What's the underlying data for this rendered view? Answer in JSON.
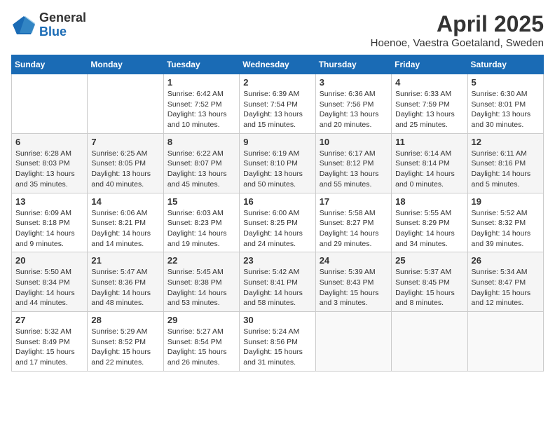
{
  "header": {
    "logo_general": "General",
    "logo_blue": "Blue",
    "month": "April 2025",
    "location": "Hoenoe, Vaestra Goetaland, Sweden"
  },
  "days_of_week": [
    "Sunday",
    "Monday",
    "Tuesday",
    "Wednesday",
    "Thursday",
    "Friday",
    "Saturday"
  ],
  "weeks": [
    [
      {
        "day": "",
        "info": ""
      },
      {
        "day": "",
        "info": ""
      },
      {
        "day": "1",
        "info": "Sunrise: 6:42 AM\nSunset: 7:52 PM\nDaylight: 13 hours and 10 minutes."
      },
      {
        "day": "2",
        "info": "Sunrise: 6:39 AM\nSunset: 7:54 PM\nDaylight: 13 hours and 15 minutes."
      },
      {
        "day": "3",
        "info": "Sunrise: 6:36 AM\nSunset: 7:56 PM\nDaylight: 13 hours and 20 minutes."
      },
      {
        "day": "4",
        "info": "Sunrise: 6:33 AM\nSunset: 7:59 PM\nDaylight: 13 hours and 25 minutes."
      },
      {
        "day": "5",
        "info": "Sunrise: 6:30 AM\nSunset: 8:01 PM\nDaylight: 13 hours and 30 minutes."
      }
    ],
    [
      {
        "day": "6",
        "info": "Sunrise: 6:28 AM\nSunset: 8:03 PM\nDaylight: 13 hours and 35 minutes."
      },
      {
        "day": "7",
        "info": "Sunrise: 6:25 AM\nSunset: 8:05 PM\nDaylight: 13 hours and 40 minutes."
      },
      {
        "day": "8",
        "info": "Sunrise: 6:22 AM\nSunset: 8:07 PM\nDaylight: 13 hours and 45 minutes."
      },
      {
        "day": "9",
        "info": "Sunrise: 6:19 AM\nSunset: 8:10 PM\nDaylight: 13 hours and 50 minutes."
      },
      {
        "day": "10",
        "info": "Sunrise: 6:17 AM\nSunset: 8:12 PM\nDaylight: 13 hours and 55 minutes."
      },
      {
        "day": "11",
        "info": "Sunrise: 6:14 AM\nSunset: 8:14 PM\nDaylight: 14 hours and 0 minutes."
      },
      {
        "day": "12",
        "info": "Sunrise: 6:11 AM\nSunset: 8:16 PM\nDaylight: 14 hours and 5 minutes."
      }
    ],
    [
      {
        "day": "13",
        "info": "Sunrise: 6:09 AM\nSunset: 8:18 PM\nDaylight: 14 hours and 9 minutes."
      },
      {
        "day": "14",
        "info": "Sunrise: 6:06 AM\nSunset: 8:21 PM\nDaylight: 14 hours and 14 minutes."
      },
      {
        "day": "15",
        "info": "Sunrise: 6:03 AM\nSunset: 8:23 PM\nDaylight: 14 hours and 19 minutes."
      },
      {
        "day": "16",
        "info": "Sunrise: 6:00 AM\nSunset: 8:25 PM\nDaylight: 14 hours and 24 minutes."
      },
      {
        "day": "17",
        "info": "Sunrise: 5:58 AM\nSunset: 8:27 PM\nDaylight: 14 hours and 29 minutes."
      },
      {
        "day": "18",
        "info": "Sunrise: 5:55 AM\nSunset: 8:29 PM\nDaylight: 14 hours and 34 minutes."
      },
      {
        "day": "19",
        "info": "Sunrise: 5:52 AM\nSunset: 8:32 PM\nDaylight: 14 hours and 39 minutes."
      }
    ],
    [
      {
        "day": "20",
        "info": "Sunrise: 5:50 AM\nSunset: 8:34 PM\nDaylight: 14 hours and 44 minutes."
      },
      {
        "day": "21",
        "info": "Sunrise: 5:47 AM\nSunset: 8:36 PM\nDaylight: 14 hours and 48 minutes."
      },
      {
        "day": "22",
        "info": "Sunrise: 5:45 AM\nSunset: 8:38 PM\nDaylight: 14 hours and 53 minutes."
      },
      {
        "day": "23",
        "info": "Sunrise: 5:42 AM\nSunset: 8:41 PM\nDaylight: 14 hours and 58 minutes."
      },
      {
        "day": "24",
        "info": "Sunrise: 5:39 AM\nSunset: 8:43 PM\nDaylight: 15 hours and 3 minutes."
      },
      {
        "day": "25",
        "info": "Sunrise: 5:37 AM\nSunset: 8:45 PM\nDaylight: 15 hours and 8 minutes."
      },
      {
        "day": "26",
        "info": "Sunrise: 5:34 AM\nSunset: 8:47 PM\nDaylight: 15 hours and 12 minutes."
      }
    ],
    [
      {
        "day": "27",
        "info": "Sunrise: 5:32 AM\nSunset: 8:49 PM\nDaylight: 15 hours and 17 minutes."
      },
      {
        "day": "28",
        "info": "Sunrise: 5:29 AM\nSunset: 8:52 PM\nDaylight: 15 hours and 22 minutes."
      },
      {
        "day": "29",
        "info": "Sunrise: 5:27 AM\nSunset: 8:54 PM\nDaylight: 15 hours and 26 minutes."
      },
      {
        "day": "30",
        "info": "Sunrise: 5:24 AM\nSunset: 8:56 PM\nDaylight: 15 hours and 31 minutes."
      },
      {
        "day": "",
        "info": ""
      },
      {
        "day": "",
        "info": ""
      },
      {
        "day": "",
        "info": ""
      }
    ]
  ]
}
